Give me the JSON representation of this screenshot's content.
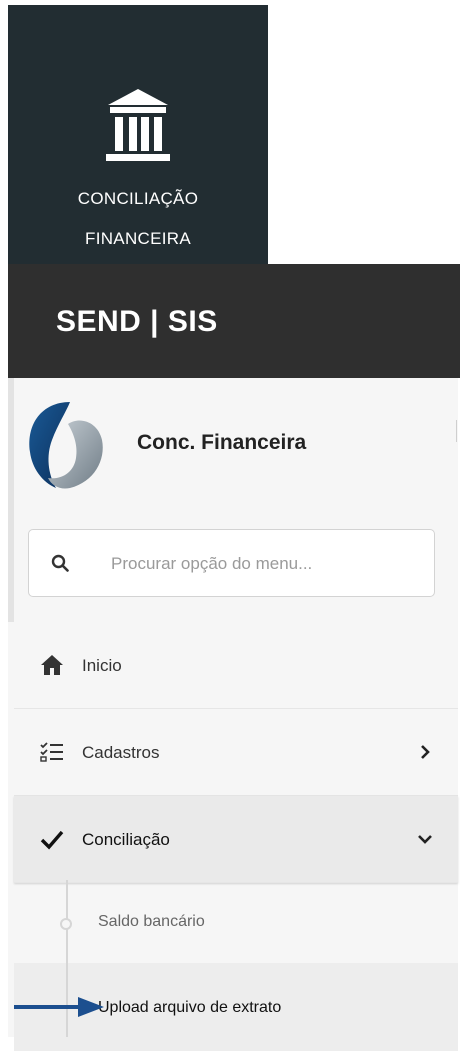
{
  "tile": {
    "line1": "CONCILIAÇÃO",
    "line2": "FINANCEIRA",
    "icon": "bank-icon"
  },
  "topbar": {
    "brand": "SEND | SIS"
  },
  "sidebar": {
    "app_name": "Conc. Financeira",
    "search": {
      "placeholder": "Procurar opção do menu..."
    },
    "items": [
      {
        "label": "Inicio",
        "icon": "home-icon"
      },
      {
        "label": "Cadastros",
        "icon": "checklist-icon",
        "chevron": "chevron-right-icon"
      },
      {
        "label": "Conciliação",
        "icon": "check-icon",
        "chevron": "chevron-down-icon",
        "expanded": true
      }
    ],
    "subitems": [
      {
        "label": "Saldo bancário"
      },
      {
        "label": "Upload arquivo de extrato",
        "current": true
      }
    ]
  },
  "colors": {
    "tile_bg": "#222d32",
    "topbar_bg": "#2f2f2f",
    "arrow": "#1c4f8f"
  }
}
